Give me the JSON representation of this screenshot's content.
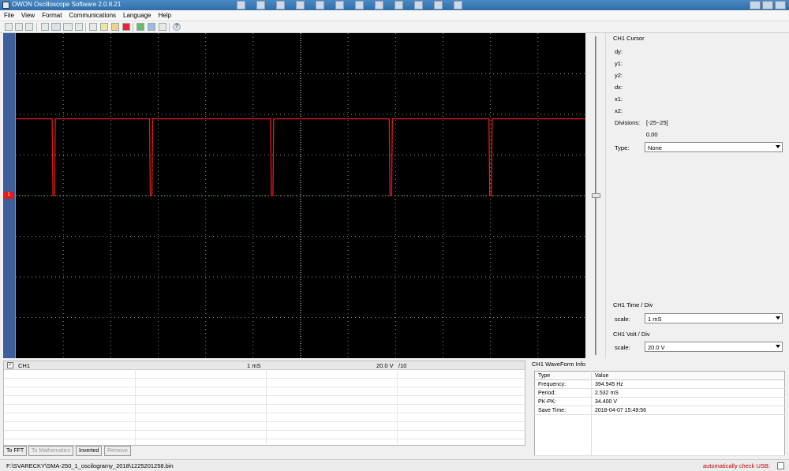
{
  "window": {
    "title": "OWON Oscilloscope Software 2.0.8.21"
  },
  "menu": [
    "File",
    "View",
    "Format",
    "Communications",
    "Language",
    "Help"
  ],
  "toolbar_icons": [
    "open-folder-icon",
    "print-icon",
    "print-preview-icon",
    "zoom-icon",
    "grid-full-icon",
    "grid-dots-icon",
    "grid-none-icon",
    "connect-icon",
    "stop-icon",
    "flag-icon",
    "record-icon",
    "save-icon",
    "export-icon",
    "copy-icon",
    "help-icon"
  ],
  "channel_marker": "1",
  "cursor_panel": {
    "title": "CH1 Cursor",
    "labels": [
      "dy:",
      "y1:",
      "y2:",
      "dx:",
      "x1:",
      "x2:"
    ],
    "divisions_label": "Divisions:",
    "divisions_range": "[-25~25]",
    "divisions_value": "0.00",
    "type_label": "Type:",
    "type_value": "None"
  },
  "time_div": {
    "title": "CH1 Time / Div",
    "scale_label": "scale:",
    "value": "1  mS"
  },
  "volt_div": {
    "title": "CH1 Volt / Div",
    "scale_label": "scale:",
    "value": "20.0 V"
  },
  "channel_list": {
    "rows": [
      {
        "name": "CH1",
        "checked": "✓",
        "time": "1  mS",
        "volt": "20.0 V",
        "probe": "/10"
      }
    ]
  },
  "buttons": {
    "to_fft": "To FFT",
    "to_math": "To Mathematics",
    "inverted": "Inverted",
    "remove": "Remove"
  },
  "waveform_info": {
    "title": "CH1 WaveForm Info",
    "headers": [
      "Type",
      "Value"
    ],
    "rows": [
      {
        "type": "Frequency:",
        "value": "394.945 Hz"
      },
      {
        "type": "Period:",
        "value": "2.532 mS"
      },
      {
        "type": "PK-PK:",
        "value": "34.400 V"
      },
      {
        "type": "Save Time:",
        "value": "2018-04-07 15:49:56"
      }
    ]
  },
  "status": {
    "path": "F:\\SVARECKY\\SMA-250_1_oscilogramy_2018\\1225201258.bin",
    "usb": "automatically check USB:"
  },
  "colors": {
    "trace": "#e21b1b",
    "screen": "#000000",
    "grid": "#8a8a8a",
    "axis": "#e0e0d0"
  },
  "waveform": {
    "base_level": 0,
    "high_level": 34.4,
    "pulses_ms": [
      0.8,
      2.85,
      5.4,
      7.9,
      10.0
    ],
    "period_ms": 2.532
  }
}
